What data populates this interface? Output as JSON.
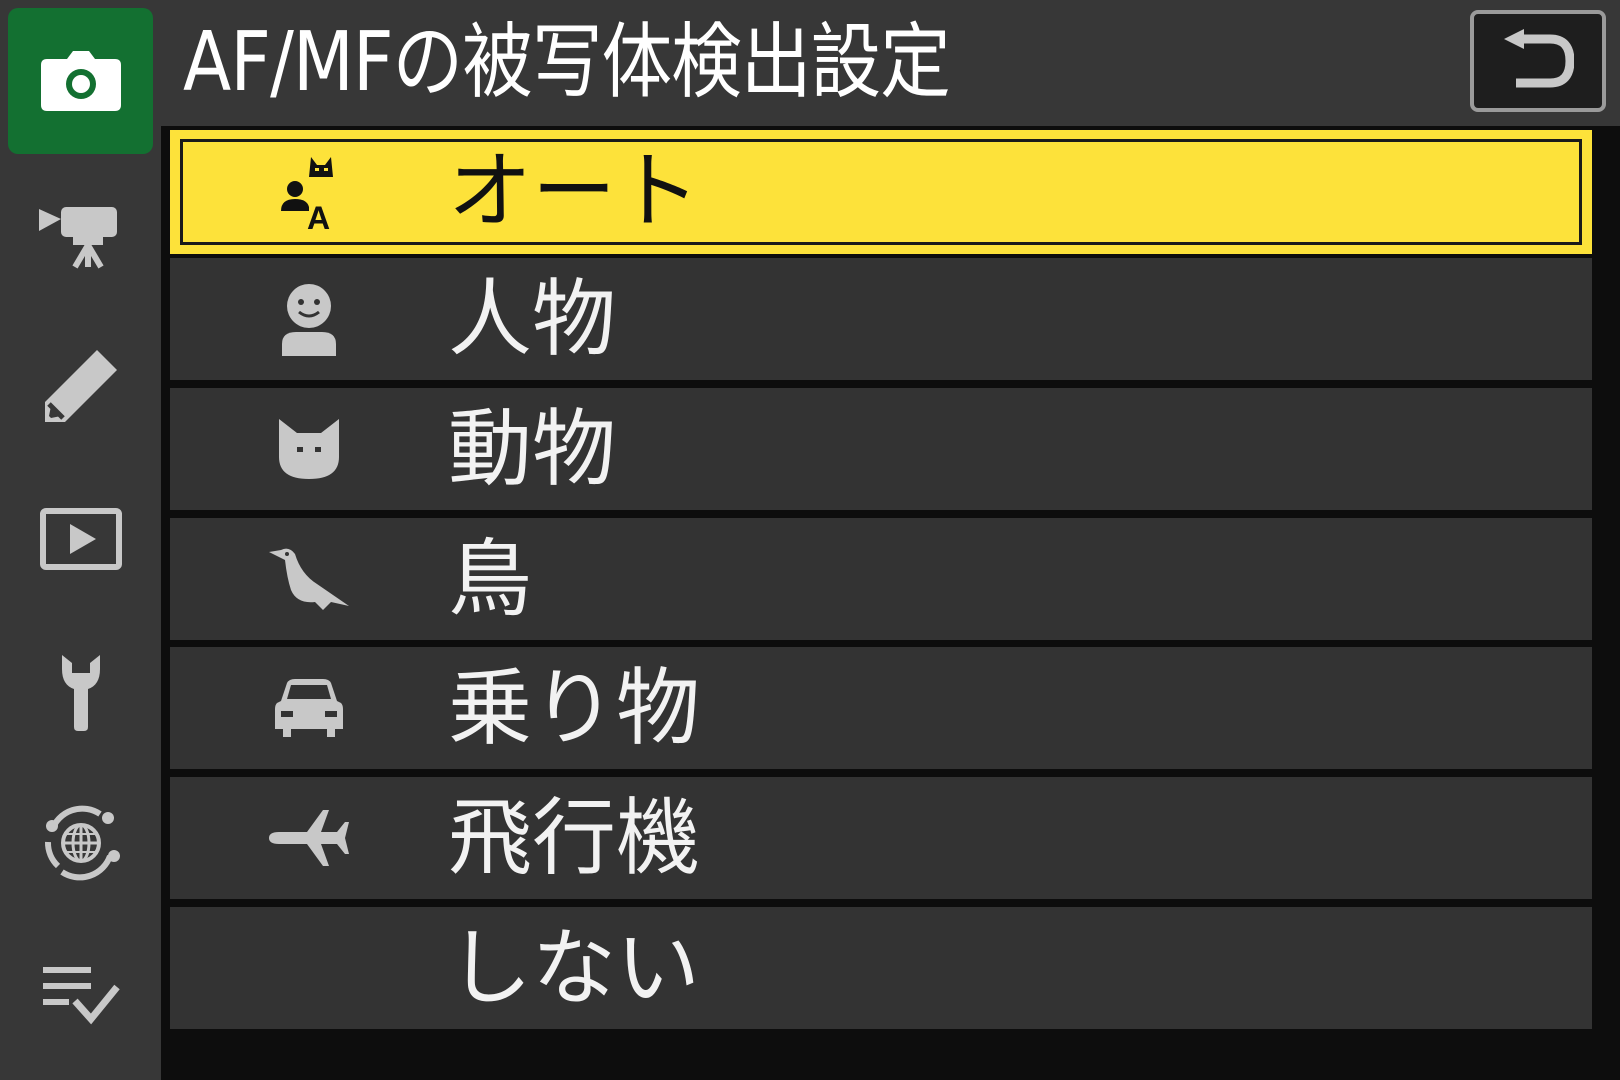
{
  "header": {
    "title": "AF/MFの被写体検出設定",
    "back_icon": "return-arrow-icon"
  },
  "sidebar": {
    "items": [
      {
        "id": "photo-shooting",
        "icon": "camera-icon",
        "active": true
      },
      {
        "id": "video-recording",
        "icon": "movie-camera-icon",
        "active": false
      },
      {
        "id": "custom-settings",
        "icon": "pencil-icon",
        "active": false
      },
      {
        "id": "playback",
        "icon": "playback-icon",
        "active": false
      },
      {
        "id": "setup",
        "icon": "wrench-icon",
        "active": false
      },
      {
        "id": "network",
        "icon": "network-globe-icon",
        "active": false
      },
      {
        "id": "my-menu",
        "icon": "my-menu-checklist-icon",
        "active": false
      }
    ]
  },
  "menu": {
    "items": [
      {
        "label": "オート",
        "icon": "auto-subject-icon",
        "selected": true
      },
      {
        "label": "人物",
        "icon": "person-icon",
        "selected": false
      },
      {
        "label": "動物",
        "icon": "animal-icon",
        "selected": false
      },
      {
        "label": "鳥",
        "icon": "bird-icon",
        "selected": false
      },
      {
        "label": "乗り物",
        "icon": "car-icon",
        "selected": false
      },
      {
        "label": "飛行機",
        "icon": "airplane-icon",
        "selected": false
      },
      {
        "label": "しない",
        "icon": "",
        "selected": false
      }
    ]
  },
  "colors": {
    "background": "#0d0d0d",
    "panel": "#373737",
    "row": "#333333",
    "selected_row": "#fde23a",
    "active_tab": "#137031",
    "icon_gray": "#c8c8c8",
    "text": "#f2f2f2"
  }
}
